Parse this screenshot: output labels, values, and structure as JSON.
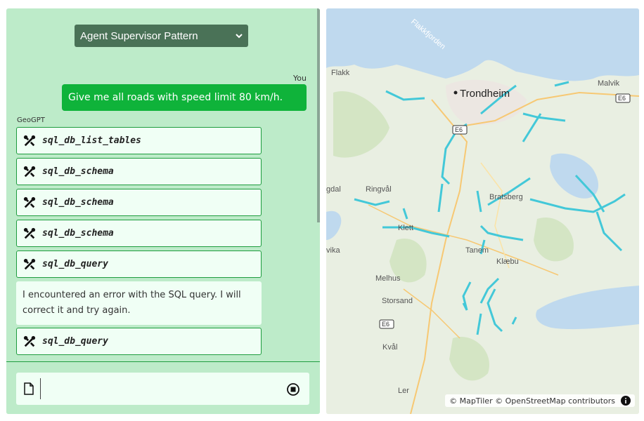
{
  "header": {
    "pattern_select": "Agent Supervisor Pattern"
  },
  "chat": {
    "user_label": "You",
    "user_message": "Give me all roads with speed limit 80 km/h.",
    "agent_label": "GeoGPT",
    "tools": [
      "sql_db_list_tables",
      "sql_db_schema",
      "sql_db_schema",
      "sql_db_schema",
      "sql_db_query"
    ],
    "error_message": "I encountered an error with the SQL query. I will correct it and try again.",
    "tool_after": "sql_db_query"
  },
  "map": {
    "attribution": "© MapTiler © OpenStreetMap contributors",
    "places": [
      "Trondheim",
      "Flakk",
      "Malvik",
      "Ringvål",
      "Bratsberg",
      "Klett",
      "Tanem",
      "Klæbu",
      "Melhus",
      "Storsand",
      "Kvål",
      "Ler",
      "vika",
      "gdal",
      "Flakkfjorden"
    ],
    "route_badges": [
      "E6",
      "E6",
      "E6"
    ]
  },
  "colors": {
    "panel": "#bdebc9",
    "user_bubble": "#0fb33a",
    "highlight": "#43c8d8"
  }
}
